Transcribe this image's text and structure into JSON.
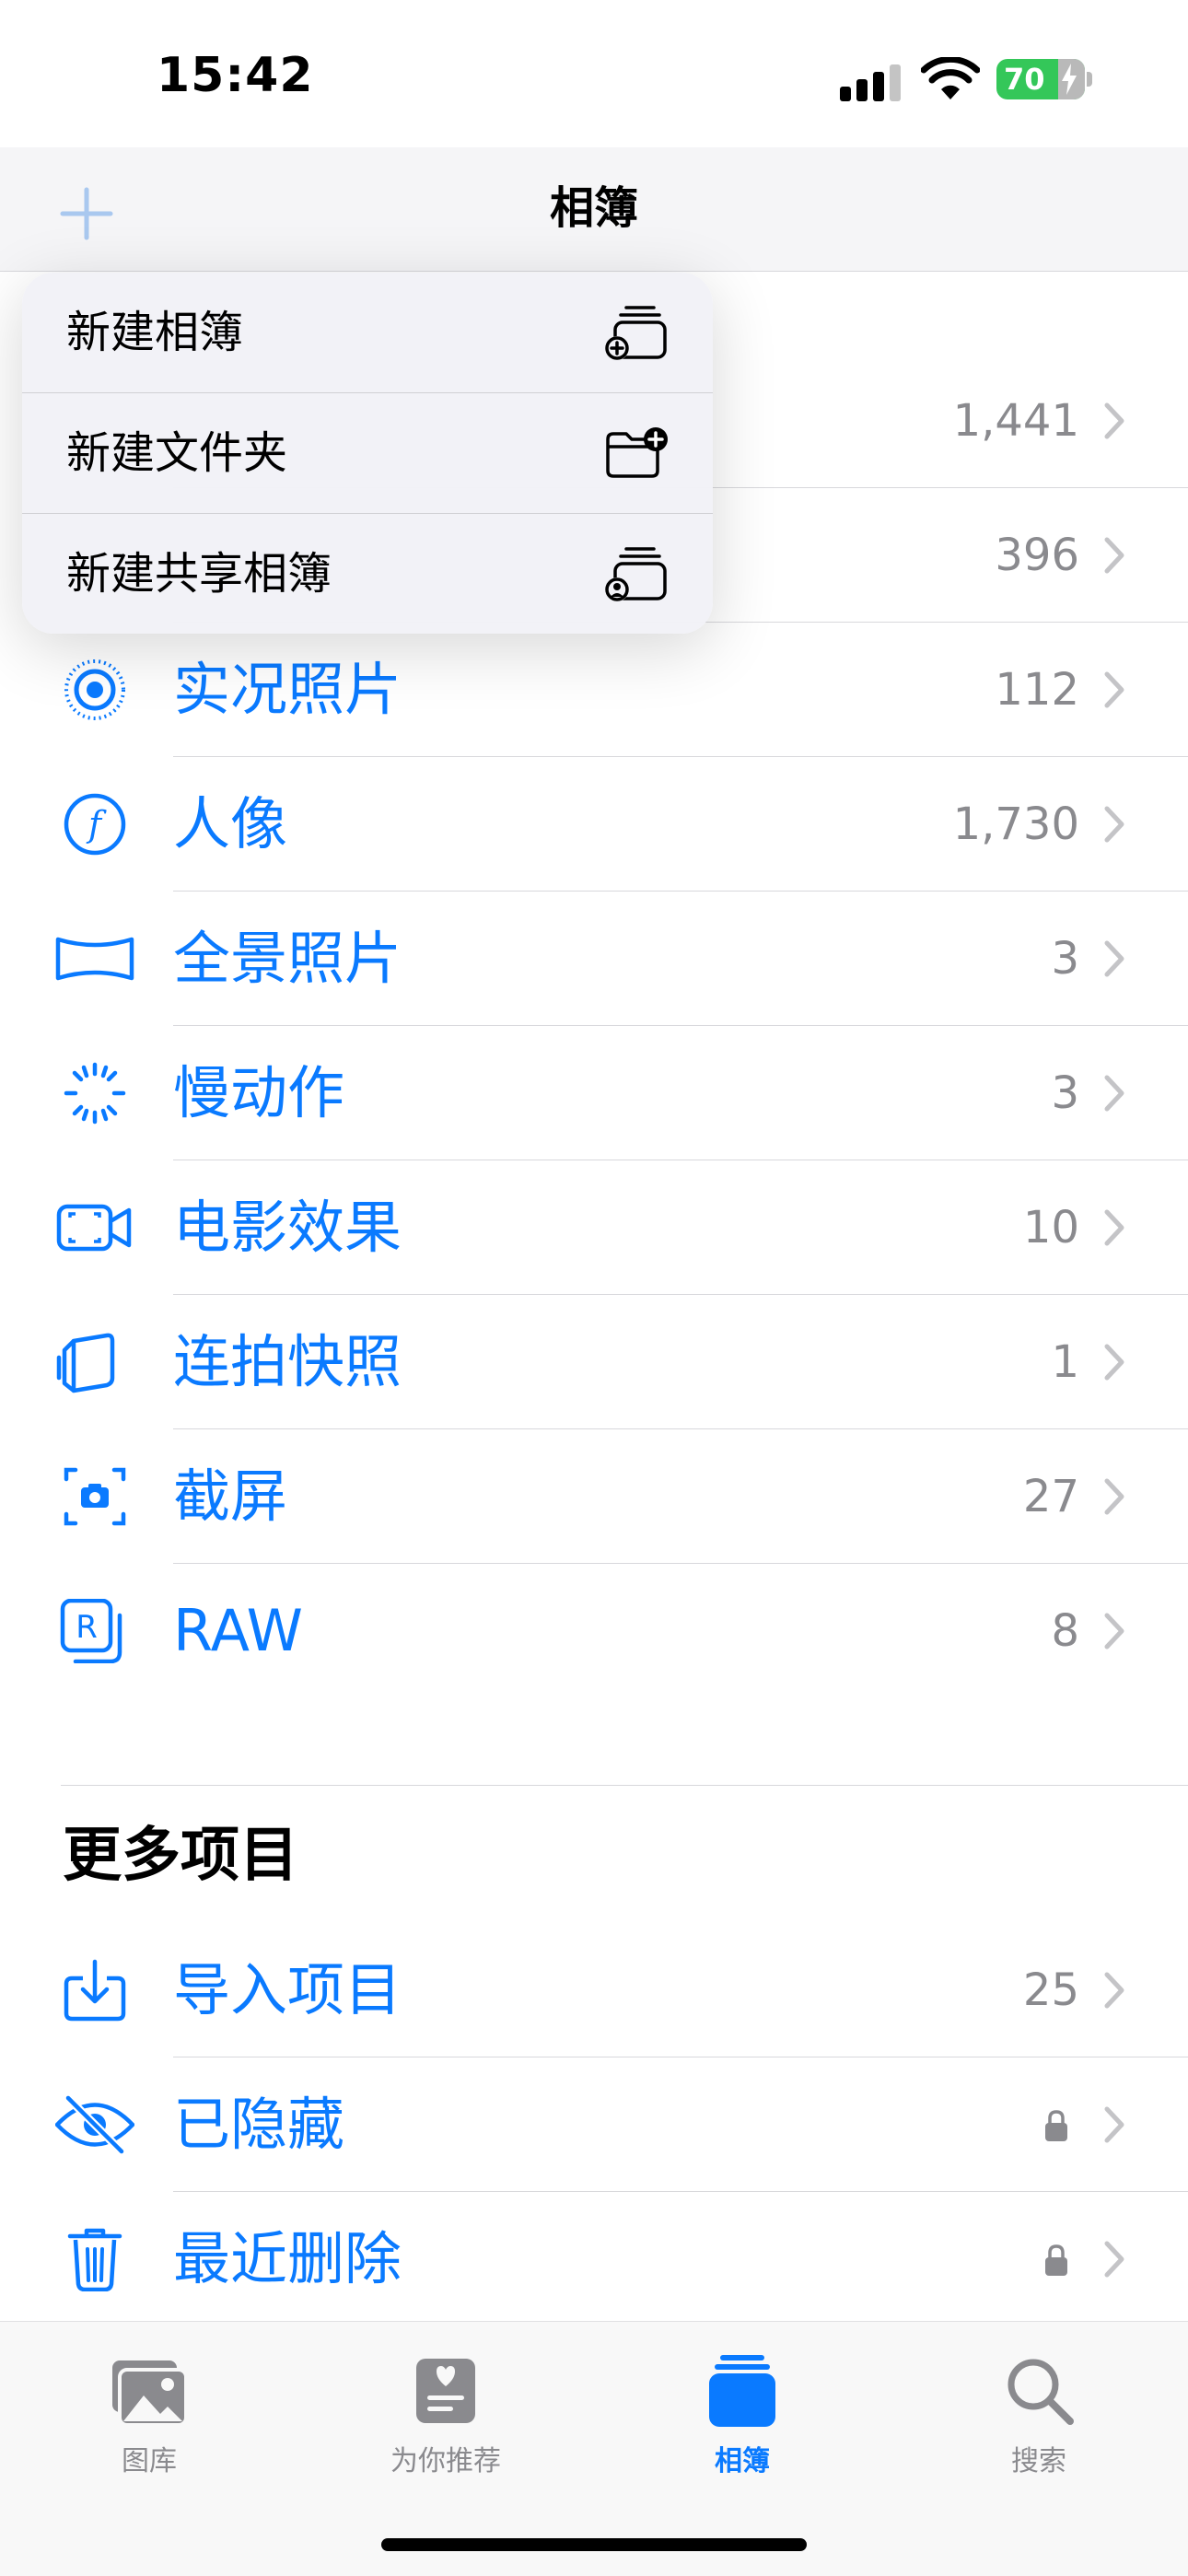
{
  "status_bar": {
    "time": "15:42",
    "battery": "70"
  },
  "nav": {
    "title": "相簿"
  },
  "menu": {
    "items": [
      {
        "label": "新建相簿"
      },
      {
        "label": "新建文件夹"
      },
      {
        "label": "新建共享相簿"
      }
    ]
  },
  "media_types": {
    "rows": [
      {
        "count": "1,441"
      },
      {
        "count": "396"
      },
      {
        "label": "实况照片",
        "count": "112"
      },
      {
        "label": "人像",
        "count": "1,730"
      },
      {
        "label": "全景照片",
        "count": "3"
      },
      {
        "label": "慢动作",
        "count": "3"
      },
      {
        "label": "电影效果",
        "count": "10"
      },
      {
        "label": "连拍快照",
        "count": "1"
      },
      {
        "label": "截屏",
        "count": "27"
      },
      {
        "label": "RAW",
        "count": "8"
      }
    ]
  },
  "more": {
    "title": "更多项目",
    "rows": [
      {
        "label": "导入项目",
        "count": "25"
      },
      {
        "label": "已隐藏"
      },
      {
        "label": "最近删除"
      }
    ]
  },
  "tabs": [
    {
      "label": "图库"
    },
    {
      "label": "为你推荐"
    },
    {
      "label": "相簿"
    },
    {
      "label": "搜索"
    }
  ],
  "colors": {
    "accent": "#0a7aff",
    "secondary_text": "#8a8a8e",
    "battery": "#34c759"
  }
}
